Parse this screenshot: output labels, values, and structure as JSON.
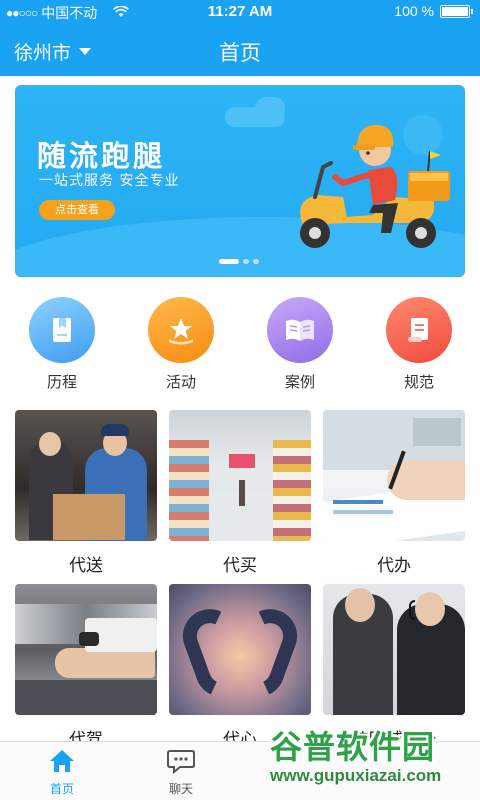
{
  "statusbar": {
    "signal_dots": "●●○○○",
    "carrier": "中国不动",
    "time": "11:27 AM",
    "battery_text": "100 %"
  },
  "navbar": {
    "city": "徐州市",
    "title": "首页"
  },
  "banner": {
    "title": "随流跑腿",
    "subtitle": "一站式服务  安全专业",
    "button": "点击查看",
    "slide_count": 3,
    "active_slide": 1
  },
  "categories": [
    {
      "label": "历程",
      "icon": "book-icon",
      "color_top": "#8dd2fb",
      "color_bottom": "#3f9cf5"
    },
    {
      "label": "活动",
      "icon": "star-icon",
      "color_top": "#ffb84c",
      "color_bottom": "#f78d12"
    },
    {
      "label": "案例",
      "icon": "open-book-icon",
      "color_top": "#c9a9f7",
      "color_bottom": "#8e6ee8"
    },
    {
      "label": "规范",
      "icon": "scroll-icon",
      "color_top": "#ff8b6e",
      "color_bottom": "#f04a3e"
    }
  ],
  "services": [
    {
      "label": "代送",
      "image": "delivery-photo"
    },
    {
      "label": "代买",
      "image": "supermarket-photo"
    },
    {
      "label": "代办",
      "image": "signing-document-photo"
    },
    {
      "label": "代驾",
      "image": "car-key-photo"
    },
    {
      "label": "代心",
      "image": "heart-hands-photo"
    },
    {
      "label": "跨区域服务",
      "image": "call-center-photo"
    }
  ],
  "tabbar": {
    "items": [
      {
        "label": "首页",
        "icon": "home-icon",
        "active": true
      },
      {
        "label": "聊天",
        "icon": "chat-icon",
        "active": false
      }
    ]
  },
  "watermark": {
    "title": "谷普软件园",
    "url": "www.gupuxiazai.com"
  },
  "colors": {
    "primary": "#1aa3f2",
    "accent_orange": "#f4a21d",
    "tab_active": "#1aa3f2",
    "tab_inactive": "#555555"
  }
}
